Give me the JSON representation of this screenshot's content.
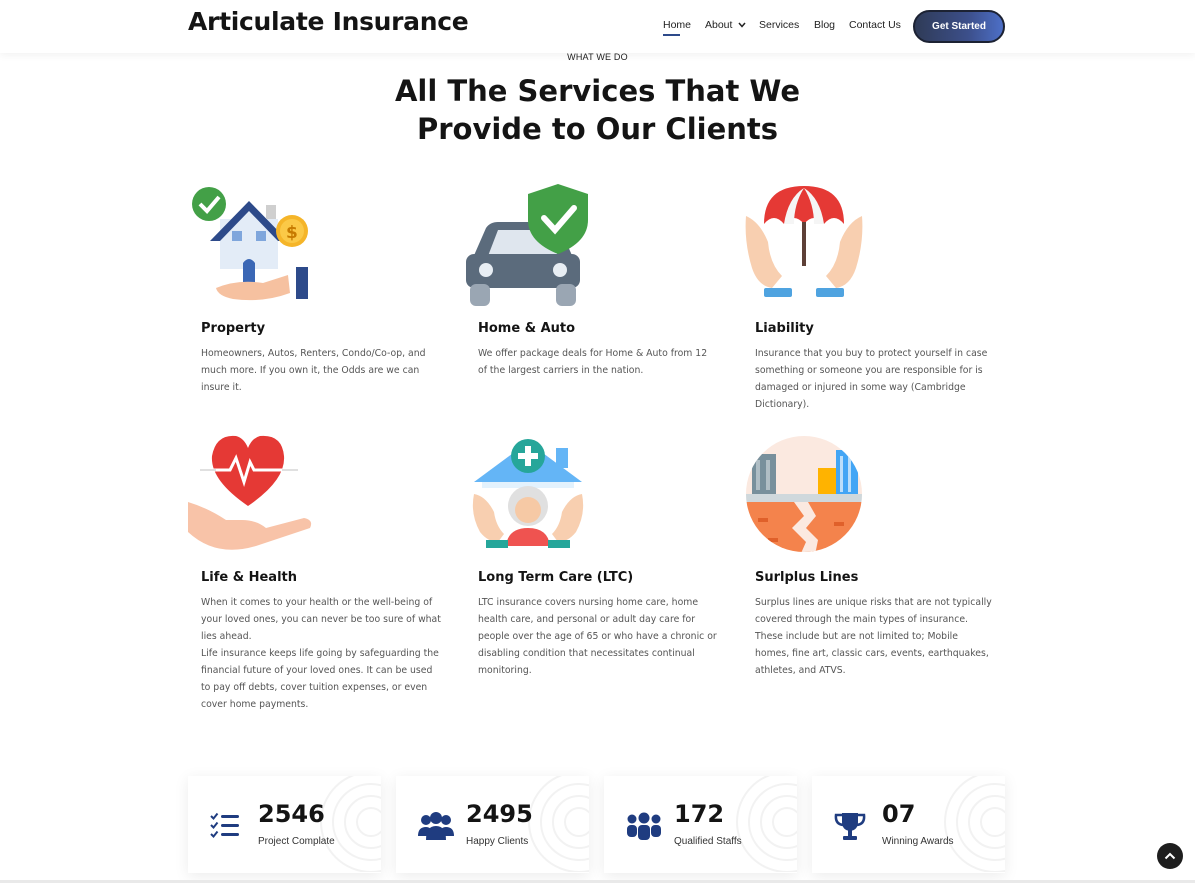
{
  "header": {
    "logo": "Articulate Insurance",
    "nav": [
      {
        "label": "Home",
        "active": true
      },
      {
        "label": "About",
        "has_dropdown": true
      },
      {
        "label": "Services"
      },
      {
        "label": "Blog"
      },
      {
        "label": "Contact Us"
      }
    ],
    "cta_label": "Get Started"
  },
  "section": {
    "kicker": "WHAT WE DO",
    "title_line1": "All The Services That We",
    "title_line2": "Provide to Our Clients"
  },
  "services": [
    {
      "title": "Property",
      "icon": "house-in-hand-icon",
      "description": "Homeowners, Autos, Renters, Condo/Co-op, and much more. If you own it, the Odds are we can insure it."
    },
    {
      "title": "Home & Auto",
      "icon": "car-shield-icon",
      "description": "We offer package deals for Home & Auto from 12 of the largest carriers in the nation."
    },
    {
      "title": "Liability",
      "icon": "umbrella-hands-icon",
      "description": "Insurance that you buy to protect yourself in case something or someone you are responsible for is damaged or injured in some way (Cambridge Dictionary)."
    },
    {
      "title": "Life & Health",
      "icon": "heart-in-hand-icon",
      "description": "When it comes to your health or the well-being of your loved ones, you can never be too sure of what lies ahead.",
      "description2": "Life insurance keeps life going by safeguarding the financial future of your loved ones. It can be used to pay off debts, cover tuition expenses, or even cover home payments."
    },
    {
      "title": "Long Term Care (LTC)",
      "icon": "elderly-care-icon",
      "description": "LTC insurance covers nursing home care, home health care, and personal or adult day care for people over the age of 65 or who have a chronic or disabling condition that necessitates continual monitoring."
    },
    {
      "title": "Surlplus Lines",
      "icon": "earthquake-city-icon",
      "description": "Surplus lines are unique risks that are not typically covered through the main types of insurance. These include but are not limited to; Mobile homes, fine art, classic cars, events, earthquakes, athletes, and ATVS."
    }
  ],
  "stats": [
    {
      "value": "2546",
      "label": "Project Complate",
      "icon": "checklist-icon"
    },
    {
      "value": "2495",
      "label": "Happy Clients",
      "icon": "users-icon"
    },
    {
      "value": "172",
      "label": "Qualified Staffs",
      "icon": "team-icon"
    },
    {
      "value": "07",
      "label": "Winning Awards",
      "icon": "trophy-icon"
    }
  ],
  "colors": {
    "accent": "#2d4a8a",
    "icon_blue": "#1f3c80",
    "text_dark": "#141414",
    "text_muted": "#555555"
  }
}
